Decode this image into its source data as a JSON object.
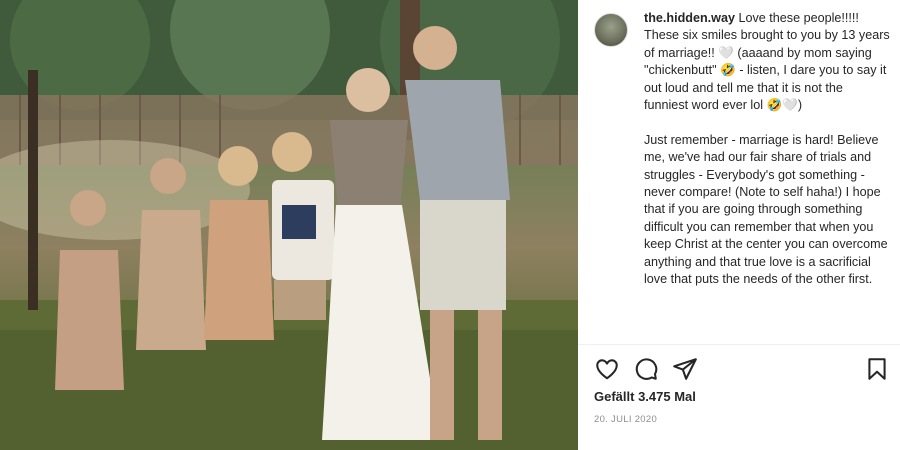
{
  "post": {
    "username": "the.hidden.way",
    "caption": " Love these people!!!!! These six smiles brought to you by 13 years of marriage!! 🤍 (aaaand by mom saying \"chickenbutt\" 🤣 - listen, I dare you to say it out loud and tell me that it is not the funniest word ever lol 🤣🤍)\n\nJust remember - marriage is hard! Believe me, we've had our fair share of trials and struggles - Everybody's got something - never compare! (Note to self haha!) I hope that if you are going through something difficult you can remember that when you keep Christ at the center you can overcome anything and that true love is a sacrificial love that puts the needs of the other first.",
    "likes": "Gefällt 3.475 Mal",
    "date": "20. JULI 2020"
  },
  "icons": {
    "like": "heart-icon",
    "comment": "comment-icon",
    "share": "paper-plane-icon",
    "save": "bookmark-icon"
  },
  "colors": {
    "text": "#262626",
    "muted": "#8e8e8e"
  }
}
